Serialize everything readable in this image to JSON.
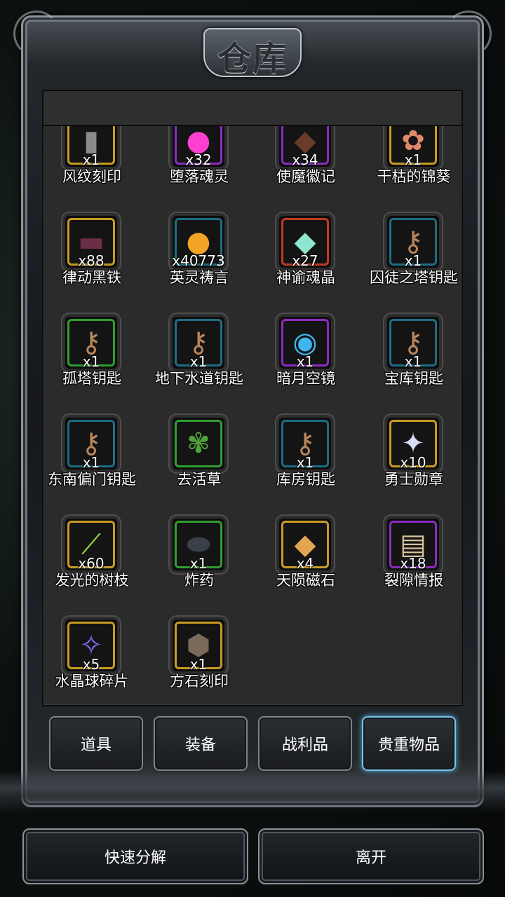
{
  "window": {
    "title": "仓库"
  },
  "items": [
    {
      "name": "风纹刻印",
      "qty": "x1",
      "rarity": "gold",
      "icon": "tablet-icon",
      "glyph": "▮",
      "color": "#8a8a8a"
    },
    {
      "name": "堕落魂灵",
      "qty": "x32",
      "rarity": "purple",
      "icon": "orb-icon",
      "glyph": "●",
      "color": "#ff3fd2"
    },
    {
      "name": "使魔徽记",
      "qty": "x34",
      "rarity": "purple",
      "icon": "emblem-icon",
      "glyph": "◆",
      "color": "#6a3b2a"
    },
    {
      "name": "干枯的锦葵",
      "qty": "x1",
      "rarity": "gold",
      "icon": "flower-icon",
      "glyph": "✿",
      "color": "#e08a6a"
    },
    {
      "name": "律动黑铁",
      "qty": "x88",
      "rarity": "gold",
      "icon": "ingot-icon",
      "glyph": "▬",
      "color": "#6b2e47"
    },
    {
      "name": "英灵祷言",
      "qty": "x40773",
      "rarity": "teal",
      "icon": "orb-icon",
      "glyph": "●",
      "color": "#f2a524"
    },
    {
      "name": "神谕魂晶",
      "qty": "x27",
      "rarity": "red",
      "icon": "crystal-icon",
      "glyph": "◆",
      "color": "#8ee6d0"
    },
    {
      "name": "囚徒之塔钥匙",
      "qty": "x1",
      "rarity": "teal",
      "icon": "key-icon",
      "glyph": "⚷",
      "color": "#b8865a"
    },
    {
      "name": "孤塔钥匙",
      "qty": "x1",
      "rarity": "green",
      "icon": "key-icon",
      "glyph": "⚷",
      "color": "#b8865a"
    },
    {
      "name": "地下水道钥匙",
      "qty": "x1",
      "rarity": "teal",
      "icon": "key-icon",
      "glyph": "⚷",
      "color": "#b8865a"
    },
    {
      "name": "暗月空镜",
      "qty": "x1",
      "rarity": "purple",
      "icon": "mirror-icon",
      "glyph": "◉",
      "color": "#3fb6f0"
    },
    {
      "name": "宝库钥匙",
      "qty": "x1",
      "rarity": "teal",
      "icon": "key-icon",
      "glyph": "⚷",
      "color": "#b8865a"
    },
    {
      "name": "东南偏门钥匙",
      "qty": "x1",
      "rarity": "teal",
      "icon": "key-icon",
      "glyph": "⚷",
      "color": "#b8865a"
    },
    {
      "name": "去活草",
      "qty": "",
      "rarity": "green",
      "icon": "herb-icon",
      "glyph": "✾",
      "color": "#4fa33a"
    },
    {
      "name": "库房钥匙",
      "qty": "x1",
      "rarity": "teal",
      "icon": "key-icon",
      "glyph": "⚷",
      "color": "#b8865a"
    },
    {
      "name": "勇士勋章",
      "qty": "x10",
      "rarity": "gold",
      "icon": "medal-icon",
      "glyph": "✦",
      "color": "#d8dcf5"
    },
    {
      "name": "发光的树枝",
      "qty": "x60",
      "rarity": "gold",
      "icon": "branch-icon",
      "glyph": "⟋",
      "color": "#8fe03a"
    },
    {
      "name": "炸药",
      "qty": "x1",
      "rarity": "green",
      "icon": "bomb-icon",
      "glyph": "⬬",
      "color": "#3a4048"
    },
    {
      "name": "天陨磁石",
      "qty": "x4",
      "rarity": "gold",
      "icon": "ore-icon",
      "glyph": "◆",
      "color": "#e2a652"
    },
    {
      "name": "裂隙情报",
      "qty": "x18",
      "rarity": "purple",
      "icon": "scroll-icon",
      "glyph": "▤",
      "color": "#d8c29a"
    },
    {
      "name": "水晶球碎片",
      "qty": "x5",
      "rarity": "gold",
      "icon": "crystal-shard-icon",
      "glyph": "✧",
      "color": "#7a6cf0"
    },
    {
      "name": "方石刻印",
      "qty": "x1",
      "rarity": "gold",
      "icon": "stone-icon",
      "glyph": "⬢",
      "color": "#7b6a5a"
    }
  ],
  "tabs": [
    {
      "label": "道具",
      "active": false
    },
    {
      "label": "装备",
      "active": false
    },
    {
      "label": "战利品",
      "active": false
    },
    {
      "label": "贵重物品",
      "active": true
    }
  ],
  "actions": {
    "decompose": "快速分解",
    "leave": "离开"
  }
}
